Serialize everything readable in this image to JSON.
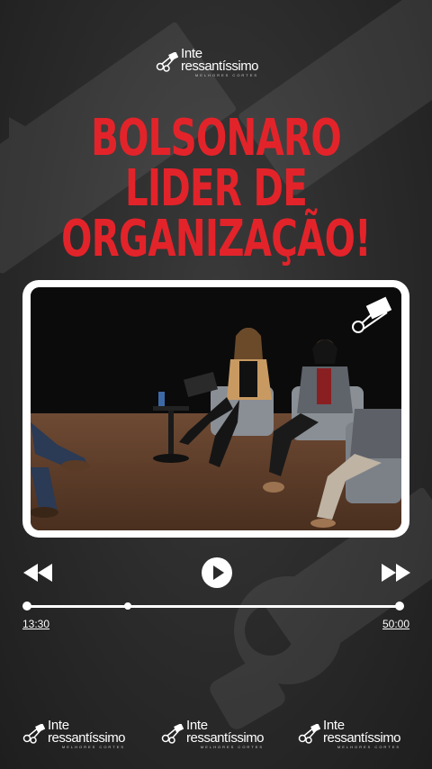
{
  "brand": {
    "line1": "Inte",
    "line2": "ressantíssimo",
    "tagline": "MELHORES CORTES"
  },
  "headline": {
    "lines": [
      "BOLSONARO",
      "LIDER DE",
      "ORGANIZAÇÃO!"
    ]
  },
  "player": {
    "current_time": "13:30",
    "total_time": "50:00",
    "progress": 0.27
  },
  "colors": {
    "headline_red": "#e3232a",
    "background": "#2a2a2a",
    "frame": "#ffffff"
  },
  "icons": {
    "rewind": "rewind-icon",
    "play": "play-icon",
    "forward": "fast-forward-icon",
    "logo": "film-scissors-icon"
  }
}
